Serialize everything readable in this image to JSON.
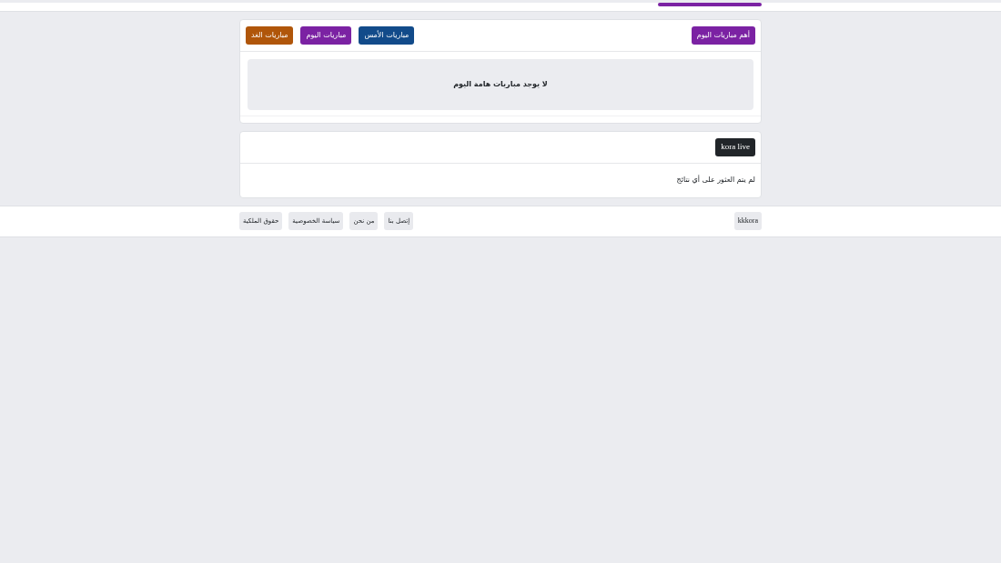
{
  "matches_card": {
    "title": "أهم مباريات اليوم",
    "day_buttons": [
      {
        "label": "مباريات الأمس",
        "color": "#124b8a"
      },
      {
        "label": "مباريات اليوم",
        "color": "#7b22a3"
      },
      {
        "label": "مباريات الغد",
        "color": "#b0560a"
      }
    ],
    "message": "لا يوجد مباريات هامة اليوم"
  },
  "results_card": {
    "badge": "kora live",
    "message": "لم يتم العثور على أي نتائج"
  },
  "footer": {
    "brand": "kkkora",
    "links": [
      "إتصل بنا",
      "من نحن",
      "سياسة الخصوصية",
      "حقوق الملكية"
    ]
  }
}
